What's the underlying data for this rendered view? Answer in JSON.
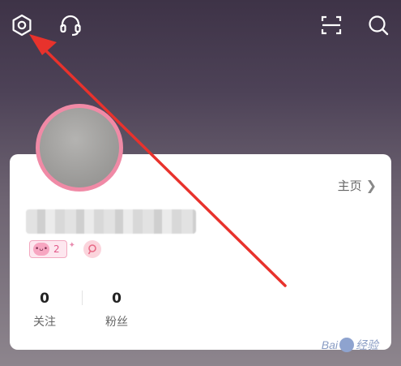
{
  "top_bar": {
    "icons": [
      "settings-icon",
      "customer-service-icon",
      "scan-icon",
      "search-icon"
    ]
  },
  "profile": {
    "homepage_label": "主页",
    "level": "2",
    "level_face": "•ᴗ•"
  },
  "stats": {
    "following": {
      "value": "0",
      "label": "关注"
    },
    "fans": {
      "value": "0",
      "label": "粉丝"
    }
  },
  "watermark": {
    "text_left": "Bai",
    "text_right": "经验"
  },
  "colors": {
    "avatar_ring": "#f08aa6",
    "annotation_arrow": "#e8322c",
    "badge": "#e1598a"
  }
}
